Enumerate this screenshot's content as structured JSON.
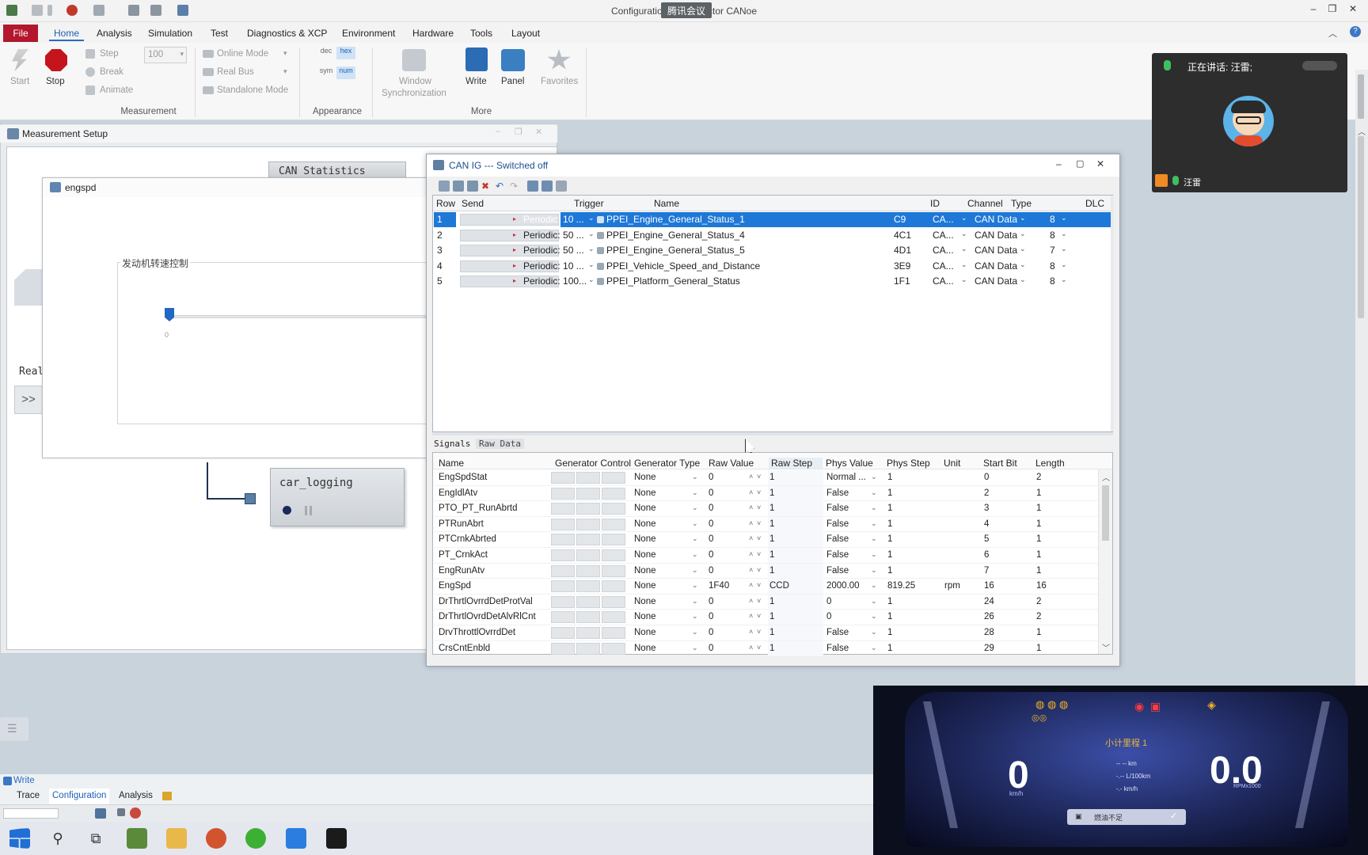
{
  "window": {
    "title": "Configuration1.cfg - Vector CANoe",
    "overlay_badge": "腾讯会议"
  },
  "menu": {
    "file": "File",
    "tabs": [
      "Home",
      "Analysis",
      "Simulation",
      "Test",
      "Diagnostics & XCP",
      "Environment",
      "Hardware",
      "Tools",
      "Layout"
    ]
  },
  "ribbon": {
    "start": "Start",
    "stop": "Stop",
    "step": "Step",
    "break": "Break",
    "animate": "Animate",
    "speed_value": "100",
    "online_mode": "Online Mode",
    "real_bus": "Real Bus",
    "standalone_mode": "Standalone Mode",
    "dec": "dec",
    "hex": "hex",
    "sym": "sym",
    "num": "num",
    "window_sync_1": "Window",
    "window_sync_2": "Synchronization",
    "write": "Write",
    "panel": "Panel",
    "favorites": "Favorites",
    "group_measurement": "Measurement",
    "group_appearance": "Appearance",
    "group_more": "More"
  },
  "measurement_setup": {
    "title": "Measurement Setup",
    "can_statistics": "CAN Statistics",
    "real_label": "Real",
    "expand": ">>",
    "car_logging": "car_logging",
    "engspd_title": "engspd",
    "group_label": "发动机转速控制",
    "slider_min": "0",
    "slider_value": 0
  },
  "canig": {
    "title": "CAN IG --- Switched off",
    "columns": [
      "Row",
      "Send",
      "Trigger",
      "Name",
      "ID",
      "Channel",
      "Type",
      "DLC"
    ],
    "messages": [
      {
        "row": "1",
        "trigger": "Periodic: 10 ...",
        "name": "PPEI_Engine_General_Status_1",
        "id": "C9",
        "channel": "CA...",
        "type": "CAN Data",
        "dlc": "8",
        "selected": true
      },
      {
        "row": "2",
        "trigger": "Periodic: 50 ...",
        "name": "PPEI_Engine_General_Status_4",
        "id": "4C1",
        "channel": "CA...",
        "type": "CAN Data",
        "dlc": "8",
        "selected": false
      },
      {
        "row": "3",
        "trigger": "Periodic: 50 ...",
        "name": "PPEI_Engine_General_Status_5",
        "id": "4D1",
        "channel": "CA...",
        "type": "CAN Data",
        "dlc": "7",
        "selected": false
      },
      {
        "row": "4",
        "trigger": "Periodic: 10 ...",
        "name": "PPEI_Vehicle_Speed_and_Distance",
        "id": "3E9",
        "channel": "CA...",
        "type": "CAN Data",
        "dlc": "8",
        "selected": false
      },
      {
        "row": "5",
        "trigger": "Periodic: 100...",
        "name": "PPEI_Platform_General_Status",
        "id": "1F1",
        "channel": "CA...",
        "type": "CAN Data",
        "dlc": "8",
        "selected": false
      }
    ],
    "tabs": [
      "Signals",
      "Raw Data"
    ],
    "signal_columns": [
      "Name",
      "Generator Control",
      "Generator Type",
      "Raw Value",
      "Raw Step",
      "Phys Value",
      "Phys Step",
      "Unit",
      "Start Bit",
      "Length"
    ],
    "signals": [
      {
        "name": "EngSpdStat",
        "gen_type": "None",
        "raw": "0",
        "raw_step": "1",
        "phys": "Normal ...",
        "phys_step": "1",
        "unit": "",
        "start": "0",
        "len": "2"
      },
      {
        "name": "EngIdlAtv",
        "gen_type": "None",
        "raw": "0",
        "raw_step": "1",
        "phys": "False",
        "phys_step": "1",
        "unit": "",
        "start": "2",
        "len": "1"
      },
      {
        "name": "PTO_PT_RunAbrtd",
        "gen_type": "None",
        "raw": "0",
        "raw_step": "1",
        "phys": "False",
        "phys_step": "1",
        "unit": "",
        "start": "3",
        "len": "1"
      },
      {
        "name": "PTRunAbrt",
        "gen_type": "None",
        "raw": "0",
        "raw_step": "1",
        "phys": "False",
        "phys_step": "1",
        "unit": "",
        "start": "4",
        "len": "1"
      },
      {
        "name": "PTCrnkAbrted",
        "gen_type": "None",
        "raw": "0",
        "raw_step": "1",
        "phys": "False",
        "phys_step": "1",
        "unit": "",
        "start": "5",
        "len": "1"
      },
      {
        "name": "PT_CrnkAct",
        "gen_type": "None",
        "raw": "0",
        "raw_step": "1",
        "phys": "False",
        "phys_step": "1",
        "unit": "",
        "start": "6",
        "len": "1"
      },
      {
        "name": "EngRunAtv",
        "gen_type": "None",
        "raw": "0",
        "raw_step": "1",
        "phys": "False",
        "phys_step": "1",
        "unit": "",
        "start": "7",
        "len": "1"
      },
      {
        "name": "EngSpd",
        "gen_type": "None",
        "raw": "1F40",
        "raw_step": "CCD",
        "phys": "2000.00",
        "phys_step": "819.25",
        "unit": "rpm",
        "start": "16",
        "len": "16"
      },
      {
        "name": "DrThrtlOvrrdDetProtVal",
        "gen_type": "None",
        "raw": "0",
        "raw_step": "1",
        "phys": "0",
        "phys_step": "1",
        "unit": "",
        "start": "24",
        "len": "2"
      },
      {
        "name": "DrThrtlOvrdDetAlvRlCnt",
        "gen_type": "None",
        "raw": "0",
        "raw_step": "1",
        "phys": "0",
        "phys_step": "1",
        "unit": "",
        "start": "26",
        "len": "2"
      },
      {
        "name": "DrvThrottlOvrrdDet",
        "gen_type": "None",
        "raw": "0",
        "raw_step": "1",
        "phys": "False",
        "phys_step": "1",
        "unit": "",
        "start": "28",
        "len": "1"
      },
      {
        "name": "CrsCntEnbld",
        "gen_type": "None",
        "raw": "0",
        "raw_step": "1",
        "phys": "False",
        "phys_step": "1",
        "unit": "",
        "start": "29",
        "len": "1"
      }
    ]
  },
  "call": {
    "speaking": "正在讲话: 汪雷;",
    "participant": "汪雷"
  },
  "cluster": {
    "trip": "小计里程 1",
    "speed": "0",
    "speed_unit": "km/h",
    "rpm": "0.0",
    "rpm_unit": "RPMx1000",
    "line1": "-- -- km",
    "line2": "-.-- L/100km",
    "line3": "-.- km/h",
    "warning": "燃油不足"
  },
  "bottom": {
    "write": "Write",
    "tabs": [
      "Trace",
      "Configuration",
      "Analysis"
    ]
  },
  "colors": {
    "accent": "#2a6bbf",
    "file_red": "#b2172d",
    "selection": "#1e78d7"
  }
}
